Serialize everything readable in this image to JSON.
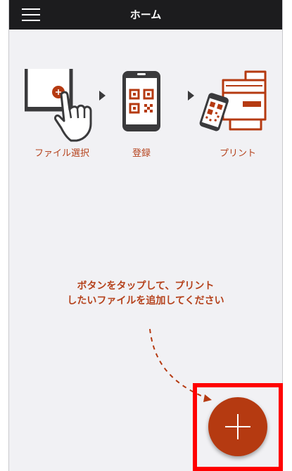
{
  "header": {
    "title": "ホーム",
    "menu_icon": "hamburger-menu-icon"
  },
  "steps": [
    {
      "label": "ファイル選択",
      "icon": "tablet-tap-icon"
    },
    {
      "label": "登録",
      "icon": "qr-code-phone-icon"
    },
    {
      "label": "プリント",
      "icon": "printer-phone-icon"
    }
  ],
  "guide": {
    "line1": "ボタンをタップして、プリント",
    "line2": "したいファイルを追加してください"
  },
  "fab": {
    "icon": "plus-icon"
  },
  "colors": {
    "accent": "#b53a11",
    "header_bg": "#1c1c1e",
    "highlight": "#ff0000",
    "background": "#f1f1f4"
  }
}
